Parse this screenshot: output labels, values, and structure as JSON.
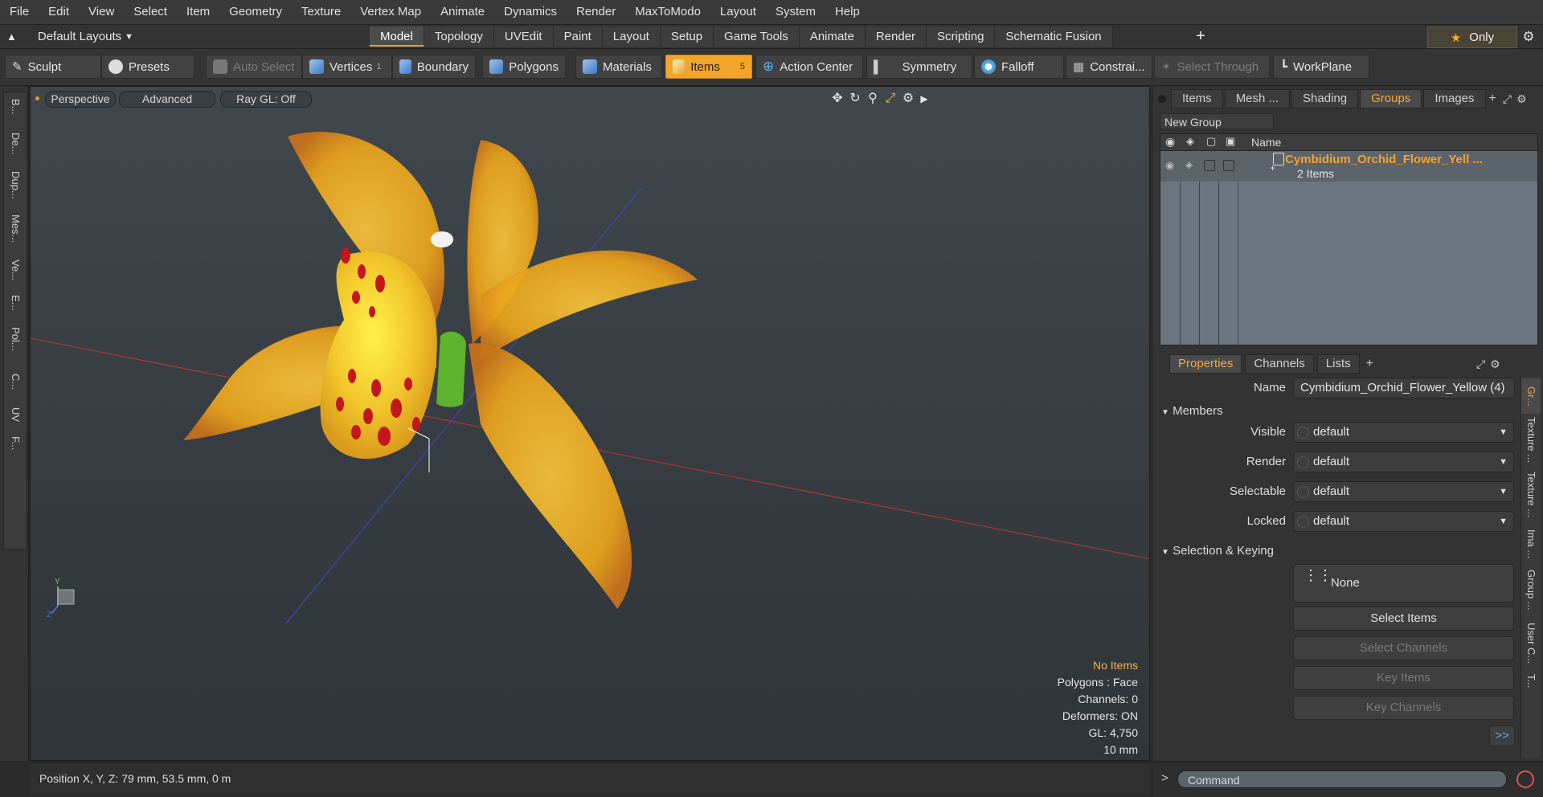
{
  "menu": [
    "File",
    "Edit",
    "View",
    "Select",
    "Item",
    "Geometry",
    "Texture",
    "Vertex Map",
    "Animate",
    "Dynamics",
    "Render",
    "MaxToModo",
    "Layout",
    "System",
    "Help"
  ],
  "layout_selector": "Default Layouts",
  "main_tabs": [
    "Model",
    "Topology",
    "UVEdit",
    "Paint",
    "Layout",
    "Setup",
    "Game Tools",
    "Animate",
    "Render",
    "Scripting",
    "Schematic Fusion"
  ],
  "active_main_tab": "Model",
  "only_label": "Only",
  "toolbar": {
    "sculpt": "Sculpt",
    "presets": "Presets",
    "auto_select": "Auto Select",
    "vertices": "Vertices",
    "vertices_count": "1",
    "boundary": "Boundary",
    "polygons": "Polygons",
    "materials": "Materials",
    "items": "Items",
    "items_count": "5",
    "action_center": "Action Center",
    "symmetry": "Symmetry",
    "falloff": "Falloff",
    "constraints": "Constrai...",
    "select_through": "Select Through",
    "workplane": "WorkPlane"
  },
  "left_tabs": [
    "B...",
    "De...",
    "Dup...",
    "Mes...",
    "Ve...",
    "E...",
    "Pol...",
    "C...",
    "UV",
    "F..."
  ],
  "viewport": {
    "perspective": "Perspective",
    "advanced": "Advanced",
    "raygl": "Ray GL: Off",
    "info": {
      "no_items": "No Items",
      "polygons": "Polygons : Face",
      "channels": "Channels: 0",
      "deformers": "Deformers: ON",
      "gl": "GL: 4,750",
      "scale": "10 mm"
    },
    "axis_y": "Y",
    "axis_z": "Z"
  },
  "status": {
    "position": "Position X, Y, Z:   79 mm, 53.5 mm, 0 m"
  },
  "right_panel": {
    "tabs": [
      "Items",
      "Mesh ...",
      "Shading",
      "Groups",
      "Images"
    ],
    "active_tab": "Groups",
    "new_group": "New Group",
    "name_header": "Name",
    "group_name": "Cymbidium_Orchid_Flower_Yell ...",
    "group_count": "2 Items"
  },
  "properties": {
    "tabs": [
      "Properties",
      "Channels",
      "Lists"
    ],
    "active_tab": "Properties",
    "name_label": "Name",
    "name_value": "Cymbidium_Orchid_Flower_Yellow (4)",
    "members_section": "Members",
    "visible_label": "Visible",
    "visible_value": "default",
    "render_label": "Render",
    "render_value": "default",
    "selectable_label": "Selectable",
    "selectable_value": "default",
    "locked_label": "Locked",
    "locked_value": "default",
    "sel_keying_section": "Selection & Keying",
    "none_label": "None",
    "select_items": "Select Items",
    "select_channels": "Select Channels",
    "key_items": "Key Items",
    "key_channels": "Key Channels",
    "more": ">>",
    "side_tabs": [
      "Gr...",
      "Texture ...",
      "Texture ...",
      "Ima ...",
      "Group ...",
      "User C...",
      "T..."
    ]
  },
  "command": {
    "placeholder": "Command",
    "prompt": ">"
  }
}
